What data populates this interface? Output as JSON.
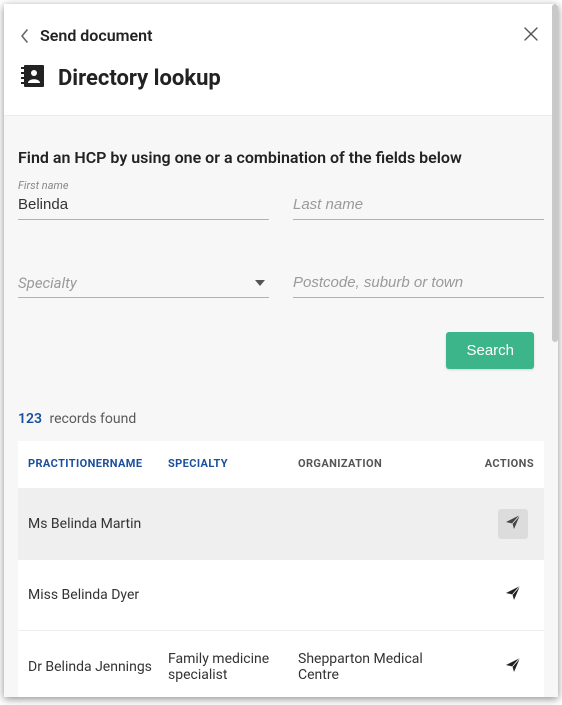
{
  "header": {
    "back_label": "Send document",
    "title": "Directory lookup"
  },
  "form": {
    "instructions": "Find an HCP by using one or a combination of the fields below",
    "first_name_label": "First name",
    "first_name_value": "Belinda",
    "last_name_placeholder": "Last name",
    "specialty_placeholder": "Specialty",
    "location_placeholder": "Postcode, suburb or town",
    "search_label": "Search"
  },
  "results": {
    "count": "123",
    "count_label": "records found",
    "columns": {
      "practitioner": "PRACTITIONERNAME",
      "specialty": "SPECIALTY",
      "organization": "ORGANIZATION",
      "actions": "ACTIONS"
    },
    "rows": [
      {
        "name": "Ms Belinda Martin",
        "specialty": "",
        "organization": "",
        "selected": true
      },
      {
        "name": "Miss Belinda Dyer",
        "specialty": "",
        "organization": "",
        "selected": false
      },
      {
        "name": "Dr Belinda Jennings",
        "specialty": "Family medicine specialist",
        "organization": "Shepparton Medical Centre",
        "selected": false
      }
    ]
  }
}
